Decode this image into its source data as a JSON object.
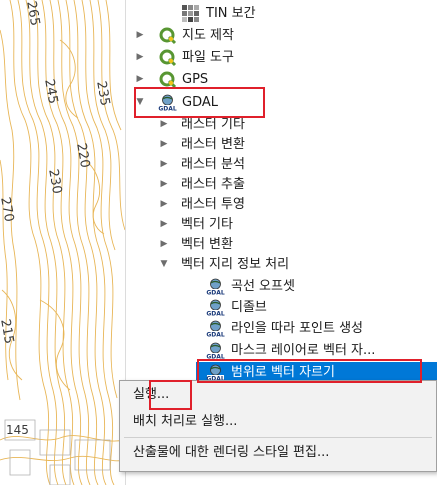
{
  "map": {
    "labels": [
      "265",
      "245",
      "235",
      "220",
      "230",
      "270",
      "215",
      "145"
    ]
  },
  "tree": {
    "items": [
      {
        "label": "TIN 보간",
        "kind": "tool-generic"
      },
      {
        "label": "지도 제작",
        "kind": "group-qgis"
      },
      {
        "label": "파일 도구",
        "kind": "group-qgis"
      },
      {
        "label": "GPS",
        "kind": "group-qgis"
      },
      {
        "label": "GDAL",
        "kind": "group-gdal"
      },
      {
        "label": "래스터 기타",
        "kind": "sub"
      },
      {
        "label": "래스터 변환",
        "kind": "sub"
      },
      {
        "label": "래스터 분석",
        "kind": "sub"
      },
      {
        "label": "래스터 추출",
        "kind": "sub"
      },
      {
        "label": "래스터 투영",
        "kind": "sub"
      },
      {
        "label": "벡터 기타",
        "kind": "sub"
      },
      {
        "label": "벡터 변환",
        "kind": "sub"
      },
      {
        "label": "벡터 지리 정보 처리",
        "kind": "sub-open"
      },
      {
        "label": "곡선 오프셋",
        "kind": "tool-gdal"
      },
      {
        "label": "디졸브",
        "kind": "tool-gdal"
      },
      {
        "label": "라인을 따라 포인트 생성",
        "kind": "tool-gdal"
      },
      {
        "label": "마스크 레이어로 벡터 자...",
        "kind": "tool-gdal"
      },
      {
        "label": "범위로 벡터 자르기",
        "kind": "tool-gdal-selected"
      }
    ]
  },
  "context_menu": {
    "items": [
      {
        "label": "실행..."
      },
      {
        "label": "배치 처리로 실행..."
      },
      {
        "label": "산출물에 대한 렌더링 스타일 편집..."
      }
    ]
  },
  "icons": {
    "qgis": "qgis-icon",
    "gdal": "gdal-icon",
    "tool": "tin-tool-icon",
    "expanded": "chevron-down-icon",
    "collapsed": "chevron-right-icon"
  },
  "colors": {
    "selection": "#0078d7",
    "highlight": "#e0202b",
    "contour": "#e8b657",
    "qgis_green": "#589632"
  }
}
